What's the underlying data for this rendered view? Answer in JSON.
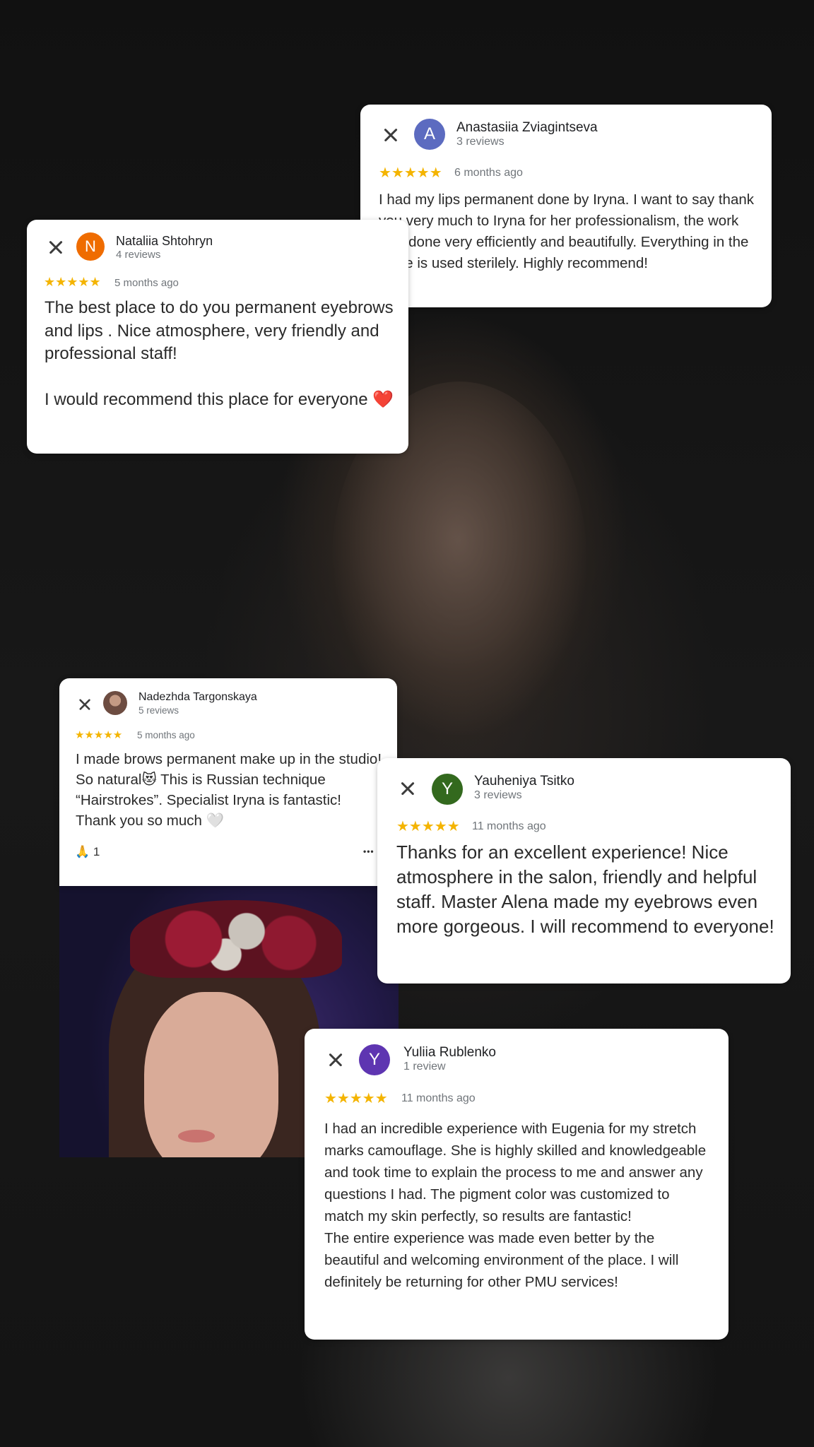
{
  "reviews": [
    {
      "name": "Anastasiia Zviagintseva",
      "count": "3 reviews",
      "avatar_letter": "A",
      "avatar_color": "#5c6bc0",
      "stars": "★★★★★",
      "age": "6 months ago",
      "text": "I had my lips permanent done by Iryna. I want to say thank you very much to Iryna for her professionalism, the work was done very efficiently and beautifully. Everything in the office is used sterilely. Highly recommend!"
    },
    {
      "name": "Nataliia Shtohryn",
      "count": "4 reviews",
      "avatar_letter": "N",
      "avatar_color": "#ef6c00",
      "stars": "★★★★★",
      "age": "5 months ago",
      "text": "The best place to do you permanent eyebrows and lips . Nice atmosphere, very friendly and professional staff!\n\nI would recommend this place for everyone ❤️"
    },
    {
      "name": "Nadezhda Targonskaya",
      "count": "5 reviews",
      "avatar_letter": "",
      "avatar_color": "#8d6e63",
      "stars": "★★★★★",
      "age": "5 months ago",
      "text": "I made brows permanent make up in the studio! So natural😻 This is Russian technique “Hairstrokes”. Specialist Iryna is fantastic! Thank you so much 🤍",
      "reaction": "🙏 1",
      "more": "•••"
    },
    {
      "name": "Yauheniya Tsitko",
      "count": "3 reviews",
      "avatar_letter": "Y",
      "avatar_color": "#33691e",
      "stars": "★★★★★",
      "age": "11 months ago",
      "text": "Thanks for an excellent experience! Nice atmosphere in the salon, friendly and helpful staff. Master Alena made my eyebrows even more gorgeous. I will recommend to everyone!"
    },
    {
      "name": "Yuliia Rublenko",
      "count": "1 review",
      "avatar_letter": "Y",
      "avatar_color": "#5e35b1",
      "stars": "★★★★★",
      "age": "11 months ago",
      "text": "I had an incredible experience with Eugenia for my stretch marks camouflage. She is highly skilled and knowledgeable and took time to explain the process to me and answer any questions I had. The pigment color was customized to match my skin perfectly, so results are fantastic!\nThe entire experience was made even better by the beautiful and welcoming environment of the place. I will definitely be returning for other PMU services!"
    }
  ]
}
